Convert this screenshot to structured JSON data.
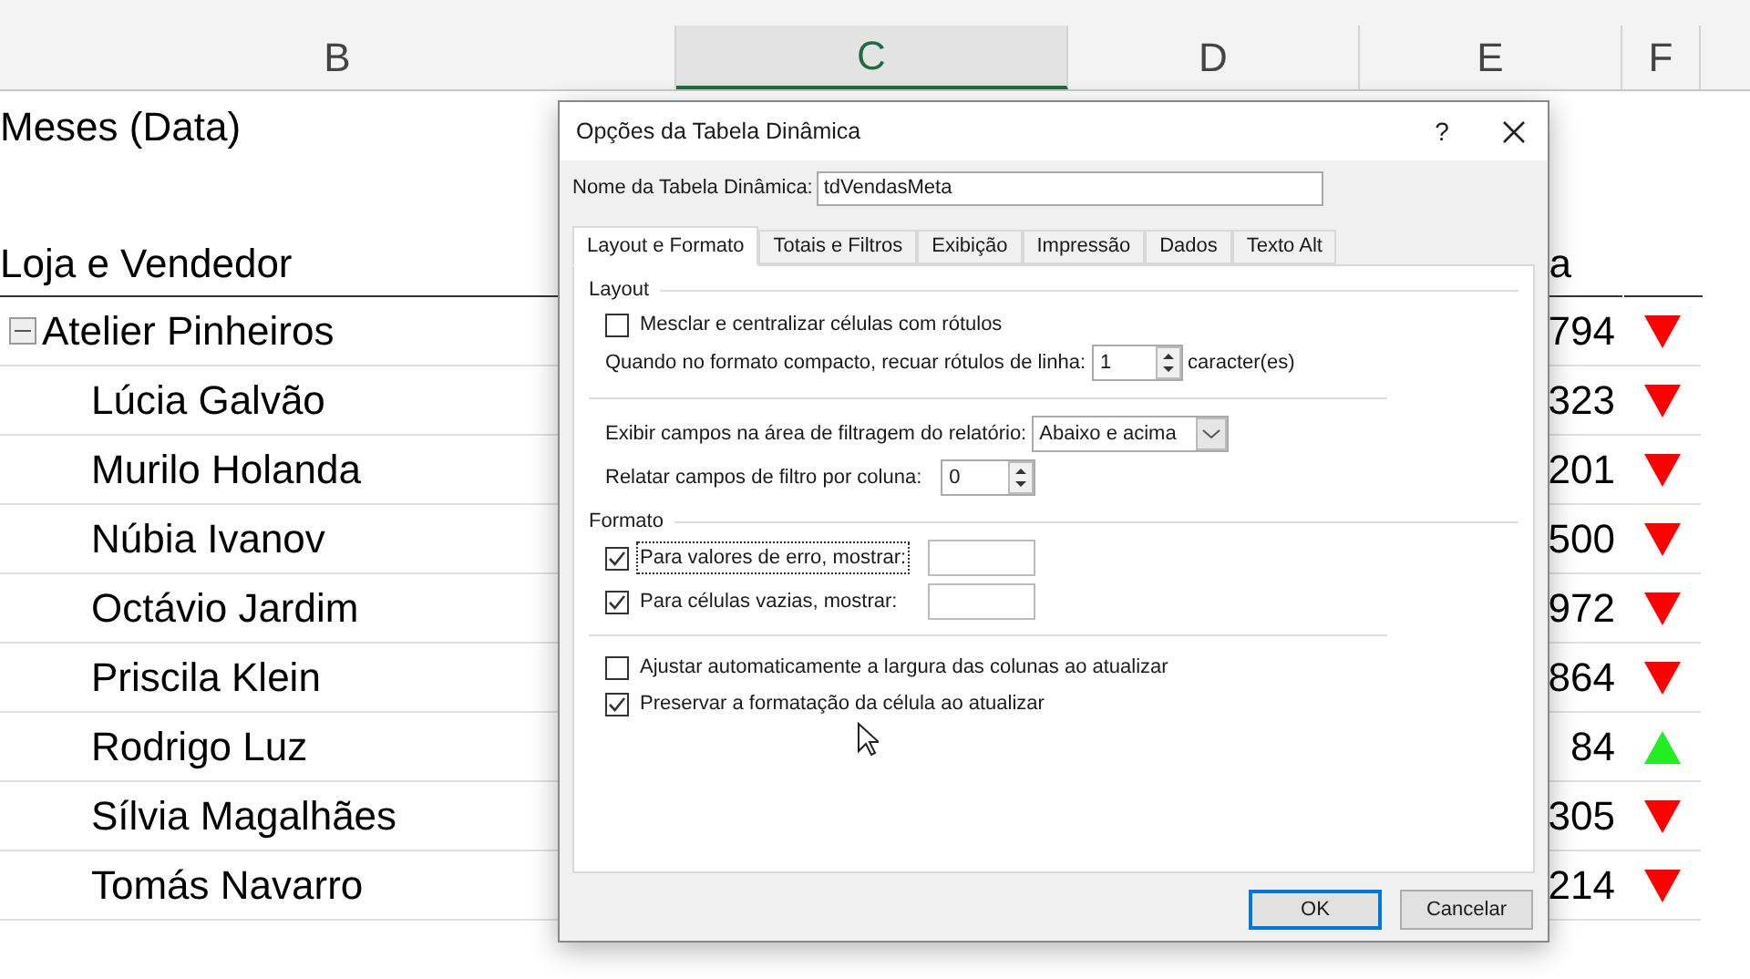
{
  "columns": [
    "B",
    "C",
    "D",
    "E",
    "F"
  ],
  "sheet": {
    "filter_label": "Meses (Data)",
    "row_header": "Loja e Vendedor",
    "value_header": "a",
    "rows": [
      {
        "name": "Atelier Pinheiros",
        "kind": "group",
        "expanded": true,
        "value": "794",
        "trend_up": false
      },
      {
        "name": "Lúcia Galvão",
        "kind": "item",
        "value": "323",
        "trend_up": false
      },
      {
        "name": "Murilo Holanda",
        "kind": "item",
        "value": "201",
        "trend_up": false
      },
      {
        "name": "Núbia Ivanov",
        "kind": "item",
        "value": "500",
        "trend_up": false
      },
      {
        "name": "Octávio Jardim",
        "kind": "item",
        "value": "972",
        "trend_up": false
      },
      {
        "name": "Priscila Klein",
        "kind": "item",
        "value": "864",
        "trend_up": false
      },
      {
        "name": "Rodrigo Luz",
        "kind": "item",
        "value": "84",
        "trend_up": true
      },
      {
        "name": "Sílvia Magalhães",
        "kind": "item",
        "value": "305",
        "trend_up": false
      },
      {
        "name": "Tomás Navarro",
        "kind": "item",
        "value": "214",
        "trend_up": false
      }
    ]
  },
  "dialog": {
    "title": "Opções da Tabela Dinâmica",
    "help": "?",
    "name_label": "Nome da Tabela Dinâmica:",
    "name_value": "tdVendasMeta",
    "tabs": [
      {
        "label": "Layout e Formato",
        "selected": true
      },
      {
        "label": "Totais e Filtros",
        "selected": false
      },
      {
        "label": "Exibição",
        "selected": false
      },
      {
        "label": "Impressão",
        "selected": false
      },
      {
        "label": "Dados",
        "selected": false
      },
      {
        "label": "Texto Alt",
        "selected": false
      }
    ],
    "layout_section": "Layout",
    "merge": {
      "label": "Mesclar e centralizar células com rótulos",
      "checked": false
    },
    "indent": {
      "label": "Quando no formato compacto, recuar rótulos de linha:",
      "value": "1",
      "unit": "caracter(es)"
    },
    "filter_area": {
      "label": "Exibir campos na área de filtragem do relatório:",
      "value": "Abaixo e acima"
    },
    "filter_cols": {
      "label": "Relatar campos de filtro por coluna:",
      "value": "0"
    },
    "format_section": "Formato",
    "error_values": {
      "label": "Para valores de erro, mostrar:",
      "checked": true
    },
    "empty_cells": {
      "label": "Para células vazias, mostrar:",
      "checked": true
    },
    "autofit": {
      "label": "Ajustar automaticamente a largura das colunas ao atualizar",
      "checked": false
    },
    "preserve": {
      "label": "Preservar a formatação da célula ao atualizar",
      "checked": true
    },
    "buttons": [
      "OK",
      "Cancelar"
    ]
  }
}
